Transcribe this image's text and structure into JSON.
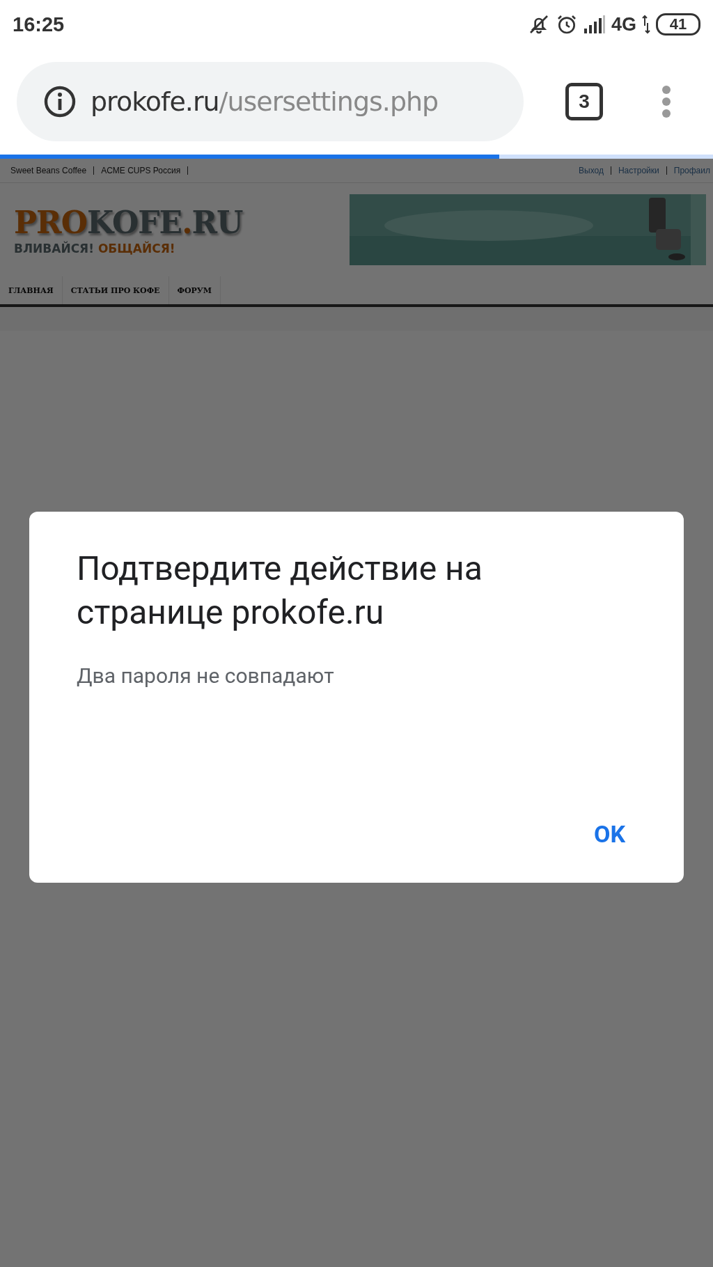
{
  "status_bar": {
    "time": "16:25",
    "network": "4G",
    "battery": "41"
  },
  "address_bar": {
    "domain": "prokofe.ru",
    "path": "/usersettings.php",
    "tab_count": "3"
  },
  "page_load": {
    "level": 0.7
  },
  "site": {
    "top_links_left": [
      "Sweet Beans Coffee",
      "ACME CUPS Россия"
    ],
    "top_links_right": [
      "Выход",
      "Настройки",
      "Профаил"
    ],
    "logo": [
      {
        "text": "PRO",
        "kind": "accent"
      },
      {
        "text": "KOFE",
        "kind": "plain"
      },
      {
        "text": ".",
        "kind": "accent"
      },
      {
        "text": "RU",
        "kind": "plain"
      }
    ],
    "tagline": [
      {
        "text": "ВЛИВАЙСЯ!",
        "kind": "plain"
      },
      {
        "text": "ОБЩАЙСЯ!",
        "kind": "accent"
      }
    ],
    "banner": {
      "kind": "picture"
    },
    "nav": [
      "ГЛАВНАЯ",
      "СТАТЬИ ПРО КОФЕ",
      "ФОРУМ"
    ]
  },
  "dialog": {
    "title": "Подтвердите действие на странице prokofe.ru",
    "message": "Два пароля не совпадают",
    "button": "OK"
  }
}
